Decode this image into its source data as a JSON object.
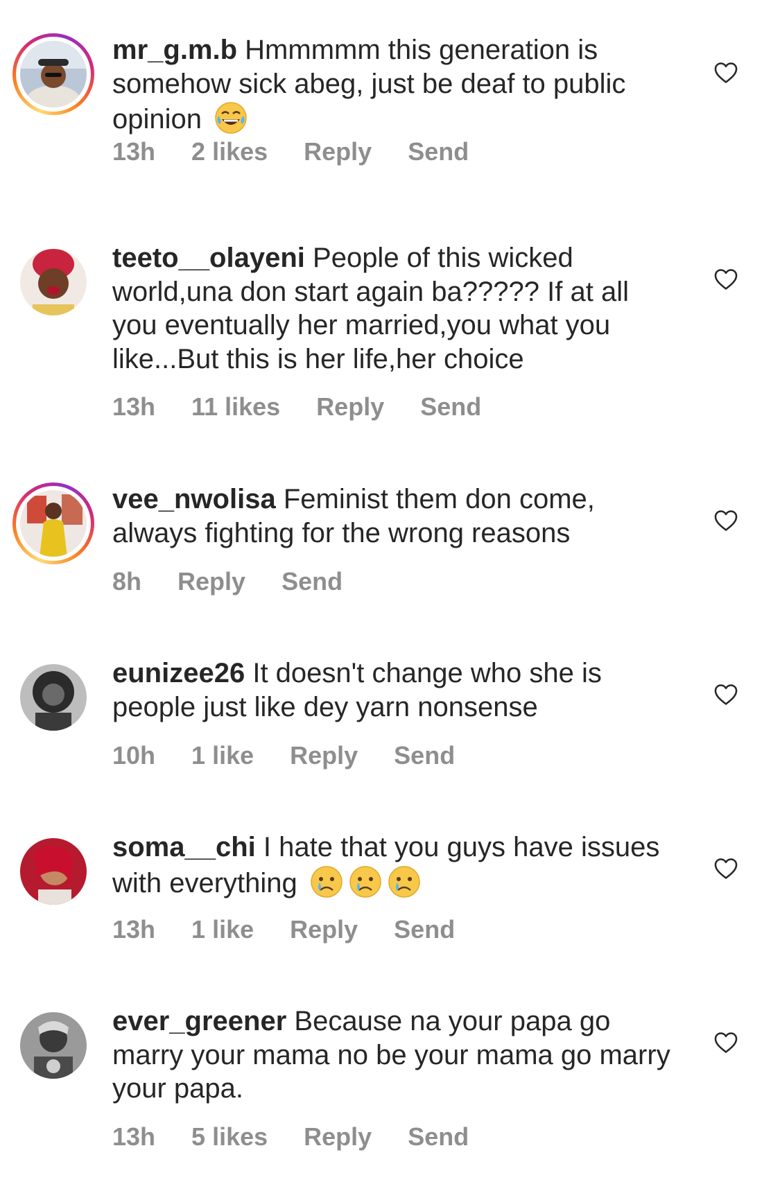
{
  "comments": [
    {
      "username": "mr_g.m.b",
      "text": "Hmmmmm this generation is somehow sick abeg, just be deaf to public opinion",
      "emoji": [
        "tears-of-joy-emoji"
      ],
      "time": "13h",
      "likes": "2 likes",
      "reply": "Reply",
      "send": "Send",
      "has_story": true
    },
    {
      "username": "teeto__olayeni",
      "text": "People of this wicked world,una don start again ba????? If at all you eventually her married,you what you like...But this is her life,her choice",
      "emoji": [],
      "time": "13h",
      "likes": "11 likes",
      "reply": "Reply",
      "send": "Send",
      "has_story": false
    },
    {
      "username": "vee_nwolisa",
      "text": "Feminist them don come, always fighting for the wrong reasons",
      "emoji": [],
      "time": "8h",
      "likes": "",
      "reply": "Reply",
      "send": "Send",
      "has_story": true
    },
    {
      "username": "eunizee26",
      "text": "It doesn't change who she is people just like dey yarn nonsense",
      "emoji": [],
      "time": "10h",
      "likes": "1 like",
      "reply": "Reply",
      "send": "Send",
      "has_story": false
    },
    {
      "username": "soma__chi",
      "text": "I hate that you guys have issues with everything",
      "emoji": [
        "crying-face-emoji",
        "crying-face-emoji",
        "crying-face-emoji"
      ],
      "time": "13h",
      "likes": "1 like",
      "reply": "Reply",
      "send": "Send",
      "has_story": false
    },
    {
      "username": "ever_greener",
      "text": "Because na your papa go marry your mama no be your mama go marry your papa.",
      "emoji": [],
      "time": "13h",
      "likes": "5 likes",
      "reply": "Reply",
      "send": "Send",
      "has_story": false
    }
  ],
  "icons": {
    "like": "heart-outline-icon"
  },
  "colors": {
    "text": "#262626",
    "meta": "#8e8e8e",
    "story_ring": [
      "#feda75",
      "#fa7e1e",
      "#d62976",
      "#962fbf"
    ]
  }
}
